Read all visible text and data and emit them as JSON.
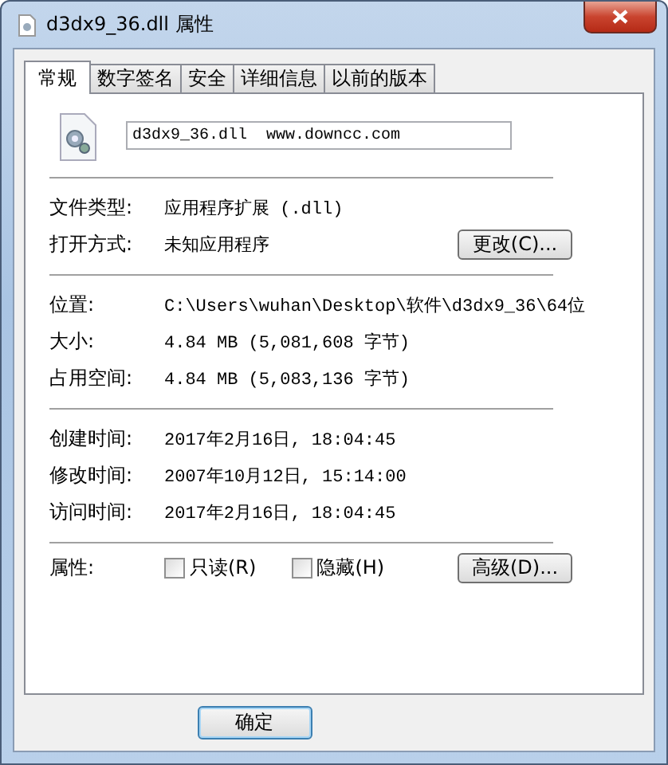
{
  "window": {
    "title": "d3dx9_36.dll 属性"
  },
  "tabs": [
    {
      "label": "常规",
      "selected": true
    },
    {
      "label": "数字签名",
      "selected": false
    },
    {
      "label": "安全",
      "selected": false
    },
    {
      "label": "详细信息",
      "selected": false
    },
    {
      "label": "以前的版本",
      "selected": false
    }
  ],
  "file_name": {
    "value": "d3dx9_36.dll  www.downcc.com"
  },
  "sections": [
    {
      "rows": [
        {
          "label": "文件类型:",
          "value": "应用程序扩展 (.dll)"
        },
        {
          "label": "打开方式:",
          "value": "未知应用程序",
          "button": "更改(C)..."
        }
      ]
    },
    {
      "rows": [
        {
          "label": "位置:",
          "value": "C:\\Users\\wuhan\\Desktop\\软件\\d3dx9_36\\64位"
        },
        {
          "label": "大小:",
          "value": "4.84 MB (5,081,608 字节)"
        },
        {
          "label": "占用空间:",
          "value": "4.84 MB (5,083,136 字节)"
        }
      ]
    },
    {
      "rows": [
        {
          "label": "创建时间:",
          "value": "2017年2月16日, 18:04:45"
        },
        {
          "label": "修改时间:",
          "value": "2007年10月12日, 15:14:00"
        },
        {
          "label": "访问时间:",
          "value": "2017年2月16日, 18:04:45"
        }
      ]
    }
  ],
  "attributes": {
    "label": "属性:",
    "checkboxes": [
      {
        "label": "只读(R)",
        "checked": false
      },
      {
        "label": "隐藏(H)",
        "checked": false
      }
    ],
    "button": "高级(D)..."
  },
  "buttons": [
    "确定"
  ]
}
